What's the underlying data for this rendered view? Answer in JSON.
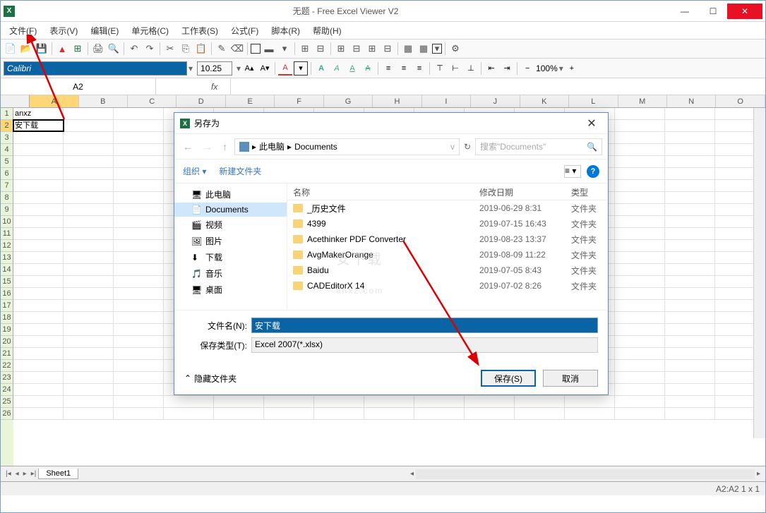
{
  "title": "无题 - Free Excel Viewer V2",
  "menu": [
    "文件(F)",
    "表示(V)",
    "编辑(E)",
    "单元格(C)",
    "工作表(S)",
    "公式(F)",
    "脚本(R)",
    "帮助(H)"
  ],
  "font": {
    "name": "Calibri",
    "size": "10.25"
  },
  "zoom": "100%",
  "namebox": "A2",
  "fx": "fx",
  "columns": [
    "A",
    "B",
    "C",
    "D",
    "E",
    "F",
    "G",
    "H",
    "I",
    "J",
    "K",
    "L",
    "M",
    "N",
    "O"
  ],
  "active_col": "A",
  "rows": 26,
  "active_row": 2,
  "cells": {
    "A1": "anxz",
    "A2": "安下载"
  },
  "sheet": "Sheet1",
  "status": "A2:A2 1 x 1",
  "dialog": {
    "title": "另存为",
    "breadcrumb": [
      "此电脑",
      "Documents"
    ],
    "search_placeholder": "搜索\"Documents\"",
    "toolbar": {
      "organize": "组织",
      "newfolder": "新建文件夹"
    },
    "nav": [
      {
        "label": "此电脑",
        "icon": "pc"
      },
      {
        "label": "Documents",
        "icon": "doc",
        "selected": true
      },
      {
        "label": "视频",
        "icon": "video"
      },
      {
        "label": "图片",
        "icon": "pic"
      },
      {
        "label": "下载",
        "icon": "down"
      },
      {
        "label": "音乐",
        "icon": "music"
      },
      {
        "label": "桌面",
        "icon": "desk"
      }
    ],
    "list_headers": {
      "name": "名称",
      "date": "修改日期",
      "type": "类型"
    },
    "files": [
      {
        "name": "_历史文件",
        "date": "2019-06-29 8:31",
        "type": "文件夹"
      },
      {
        "name": "4399",
        "date": "2019-07-15 16:43",
        "type": "文件夹"
      },
      {
        "name": "Acethinker PDF Converter",
        "date": "2019-08-23 13:37",
        "type": "文件夹"
      },
      {
        "name": "AvgMakerOrange",
        "date": "2019-08-09 11:22",
        "type": "文件夹"
      },
      {
        "name": "Baidu",
        "date": "2019-07-05 8:43",
        "type": "文件夹"
      },
      {
        "name": "CADEditorX 14",
        "date": "2019-07-02 8:26",
        "type": "文件夹"
      }
    ],
    "filename_label": "文件名(N):",
    "filename_value": "安下载",
    "filetype_label": "保存类型(T):",
    "filetype_value": "Excel 2007(*.xlsx)",
    "hide_folders": "隐藏文件夹",
    "save": "保存(S)",
    "cancel": "取消"
  },
  "watermark": "anxz.com"
}
